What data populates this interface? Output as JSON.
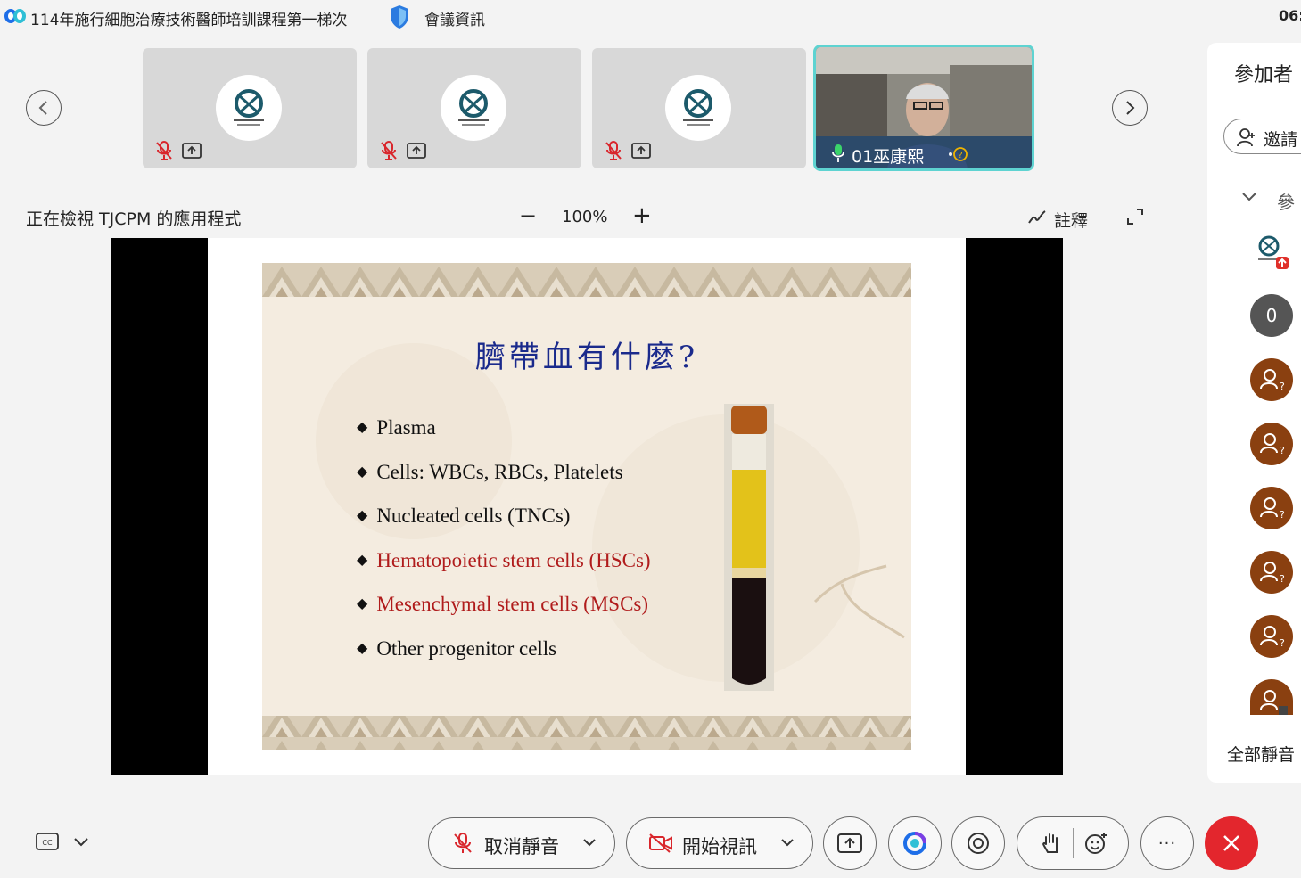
{
  "titlebar": {
    "meeting_title": "114年施行細胞治療技術醫師培訓課程第一梯次",
    "info_label": "會議資訊",
    "clock": "06:"
  },
  "filmstrip": {
    "speaker_name": "01巫康熙"
  },
  "viewbar": {
    "viewing_label": "正在檢視 TJCPM 的應用程式",
    "zoom_minus": "−",
    "zoom_value": "100%",
    "zoom_plus": "+",
    "annotate_label": "註釋"
  },
  "slide": {
    "title": "臍帶血有什麼?",
    "bullets": [
      "Plasma",
      "Cells: WBCs, RBCs, Platelets",
      "Nucleated cells (TNCs)",
      "Hematopoietic stem cells (HSCs)",
      "Mesenchymal stem cells (MSCs)",
      "Other progenitor cells"
    ],
    "colors": {
      "title": "#1a2a8c",
      "highlight": "#b01c1c"
    }
  },
  "panel": {
    "title": "參加者",
    "invite_label": "邀請",
    "section_label": "參",
    "count_badge": "0",
    "mute_all": "全部靜音"
  },
  "toolbar": {
    "unmute_label": "取消靜音",
    "start_video_label": "開始視訊",
    "more_label": "···"
  }
}
